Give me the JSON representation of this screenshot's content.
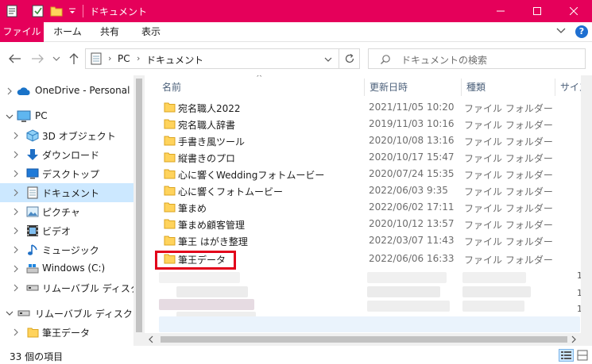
{
  "window": {
    "title": "ドキュメント",
    "accent_color": "#e5005a"
  },
  "ribbon": {
    "tabs": [
      "ファイル",
      "ホーム",
      "共有",
      "表示"
    ],
    "help_label": "?"
  },
  "address": {
    "crumbs": [
      "PC",
      "ドキュメント"
    ],
    "search_placeholder": "ドキュメントの検索"
  },
  "sidebar": {
    "items": [
      {
        "label": "OneDrive - Personal",
        "icon": "cloud-icon"
      },
      {
        "label": "PC",
        "icon": "pc-icon"
      },
      {
        "label": "3D オブジェクト",
        "icon": "3d-objects-icon"
      },
      {
        "label": "ダウンロード",
        "icon": "download-icon"
      },
      {
        "label": "デスクトップ",
        "icon": "desktop-icon"
      },
      {
        "label": "ドキュメント",
        "icon": "document-icon",
        "selected": true
      },
      {
        "label": "ピクチャ",
        "icon": "pictures-icon"
      },
      {
        "label": "ビデオ",
        "icon": "videos-icon"
      },
      {
        "label": "ミュージック",
        "icon": "music-icon"
      },
      {
        "label": "Windows (C:)",
        "icon": "drive-icon"
      },
      {
        "label": "リムーバブル ディスク (D:)",
        "icon": "removable-drive-icon"
      },
      {
        "label": "リムーバブル ディスク (D:)",
        "icon": "removable-drive-icon"
      },
      {
        "label": "筆王データ",
        "icon": "folder-icon"
      }
    ]
  },
  "filelist": {
    "columns": [
      "名前",
      "更新日時",
      "種類",
      "サイズ"
    ],
    "rows": [
      {
        "name": "宛名職人2022",
        "date": "2021/11/05 10:20",
        "type": "ファイル フォルダー"
      },
      {
        "name": "宛名職人辞書",
        "date": "2019/11/03 10:16",
        "type": "ファイル フォルダー"
      },
      {
        "name": "手書き風ツール",
        "date": "2020/10/08 13:16",
        "type": "ファイル フォルダー"
      },
      {
        "name": "縦書きのプロ",
        "date": "2020/10/17 15:47",
        "type": "ファイル フォルダー"
      },
      {
        "name": "心に響くWeddingフォトムービー",
        "date": "2020/07/24 15:35",
        "type": "ファイル フォルダー"
      },
      {
        "name": "心に響くフォトムービー",
        "date": "2022/06/03 9:35",
        "type": "ファイル フォルダー"
      },
      {
        "name": "筆まめ",
        "date": "2022/06/02 17:11",
        "type": "ファイル フォルダー"
      },
      {
        "name": "筆まめ顧客管理",
        "date": "2020/10/12 13:57",
        "type": "ファイル フォルダー"
      },
      {
        "name": "筆王 はがき整理",
        "date": "2022/03/07 11:43",
        "type": "ファイル フォルダー"
      },
      {
        "name": "筆王データ",
        "date": "2022/06/06 16:33",
        "type": "ファイル フォルダー"
      }
    ],
    "size_fragments": [
      "1",
      "1",
      "1"
    ]
  },
  "status": {
    "item_count": "33 個の項目"
  }
}
